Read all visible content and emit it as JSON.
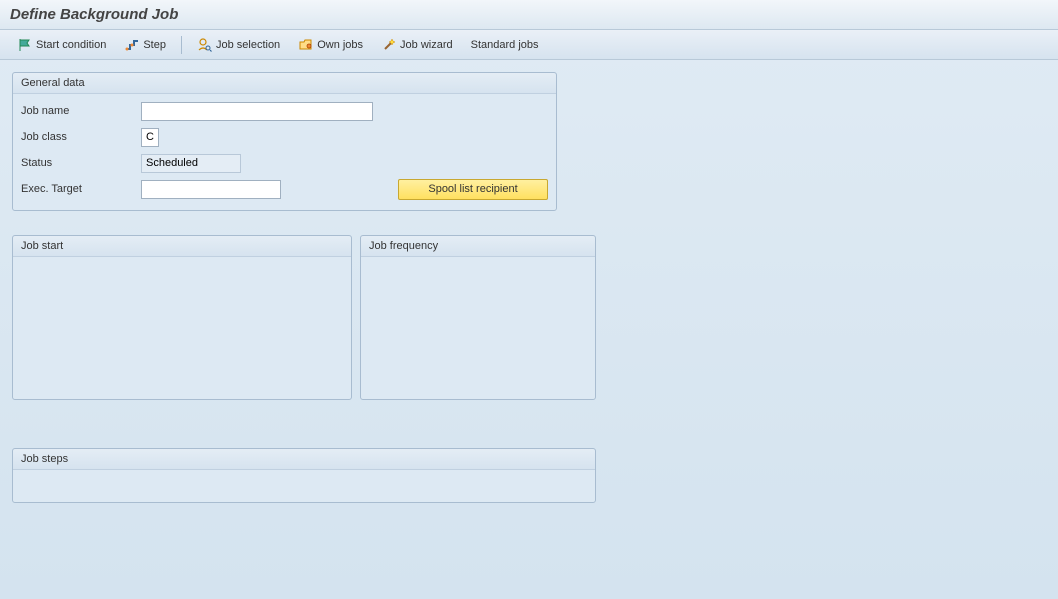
{
  "header": {
    "title": "Define Background Job"
  },
  "toolbar": {
    "start_condition": "Start condition",
    "step": "Step",
    "job_selection": "Job selection",
    "own_jobs": "Own jobs",
    "job_wizard": "Job wizard",
    "standard_jobs": "Standard jobs"
  },
  "general": {
    "title": "General data",
    "job_name_label": "Job name",
    "job_name_value": "",
    "job_class_label": "Job class",
    "job_class_value": "C",
    "status_label": "Status",
    "status_value": "Scheduled",
    "exec_target_label": "Exec. Target",
    "exec_target_value": "",
    "spool_btn": "Spool list recipient"
  },
  "job_start": {
    "title": "Job start"
  },
  "job_frequency": {
    "title": "Job frequency"
  },
  "job_steps": {
    "title": "Job steps"
  }
}
